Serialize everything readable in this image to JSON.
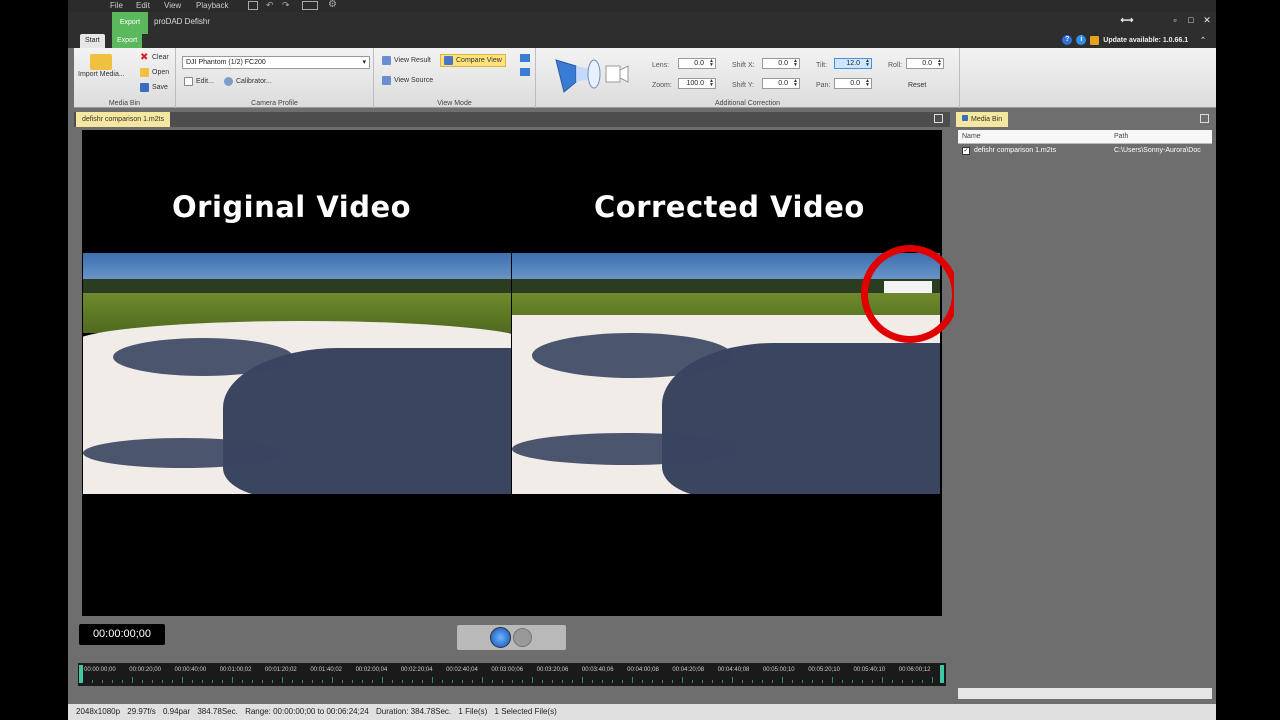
{
  "menu": [
    "File",
    "Edit",
    "View",
    "Playback"
  ],
  "title_bar": {
    "export_tab": "Export",
    "app_title": "proDAD Defishr",
    "controls": {
      "swap": "⟷",
      "minimize": "▫",
      "maximize": "□",
      "close": "✕"
    }
  },
  "ribbon_tabs": {
    "start": "Start",
    "export": "Export"
  },
  "update": {
    "text": "Update available: 1.0.66.1",
    "help_icon": "?",
    "info_icon": "i"
  },
  "media_bin_group": {
    "import": "Import Media...",
    "clear": "Clear",
    "open": "Open",
    "save": "Save",
    "label": "Media Bin"
  },
  "camera_profile": {
    "selected": "DJI Phantom (1/2) FC200",
    "edit": "Edit...",
    "calibrator": "Calibrator...",
    "label": "Camera Profile"
  },
  "view_mode": {
    "view_result": "View Result",
    "compare_view": "Compare View",
    "view_source": "View Source",
    "label": "View Mode"
  },
  "correction": {
    "lens_label": "Lens:",
    "lens": "0.0",
    "zoom_label": "Zoom:",
    "zoom": "100.0",
    "shift_x_label": "Shift X:",
    "shift_x": "0.0",
    "shift_y_label": "Shift Y:",
    "shift_y": "0.0",
    "tilt_label": "Tilt:",
    "tilt": "12.0",
    "pan_label": "Pan:",
    "pan": "0.0",
    "roll_label": "Roll:",
    "roll": "0.0",
    "reset": "Reset",
    "label": "Additional Correction"
  },
  "document_tab": "defishr comparison 1.m2ts",
  "viewer": {
    "left_title": "Original Video",
    "right_title": "Corrected Video"
  },
  "transport": {
    "timecode": "00:00:00;00"
  },
  "timeline": {
    "ticks": [
      "00:00:00;00",
      "00:00:20;00",
      "00:00:40;00",
      "00:01:00;02",
      "00:01:20;02",
      "00:01:40;02",
      "00:02:00;04",
      "00:02:20;04",
      "00:02:40;04",
      "00:03:00;06",
      "00:03:20;06",
      "00:03:40;06",
      "00:04:00;08",
      "00:04:20;08",
      "00:04:40;08",
      "00:05:00;10",
      "00:05:20;10",
      "00:05:40;10",
      "00:06:00;12"
    ]
  },
  "media_bin": {
    "tab": "Media Bin",
    "col_name": "Name",
    "col_path": "Path",
    "file_name": "defishr comparison 1.m2ts",
    "file_path": "C:\\Users\\Sonny-Aurora\\Doc"
  },
  "status": {
    "resolution": "2048x1080p",
    "fps": "29.97f/s",
    "par": "0.94par",
    "length": "384.78Sec.",
    "range": "Range: 00:00:00;00 to 00:06:24;24",
    "duration": "Duration: 384.78Sec.",
    "files": "1 File(s)",
    "selected": "1 Selected File(s)"
  },
  "colors": {
    "export_green": "#5cb85c",
    "highlight_red": "#e00000",
    "tab_yellow": "#f5e6a0",
    "timeline_teal": "#3fc7a6"
  }
}
